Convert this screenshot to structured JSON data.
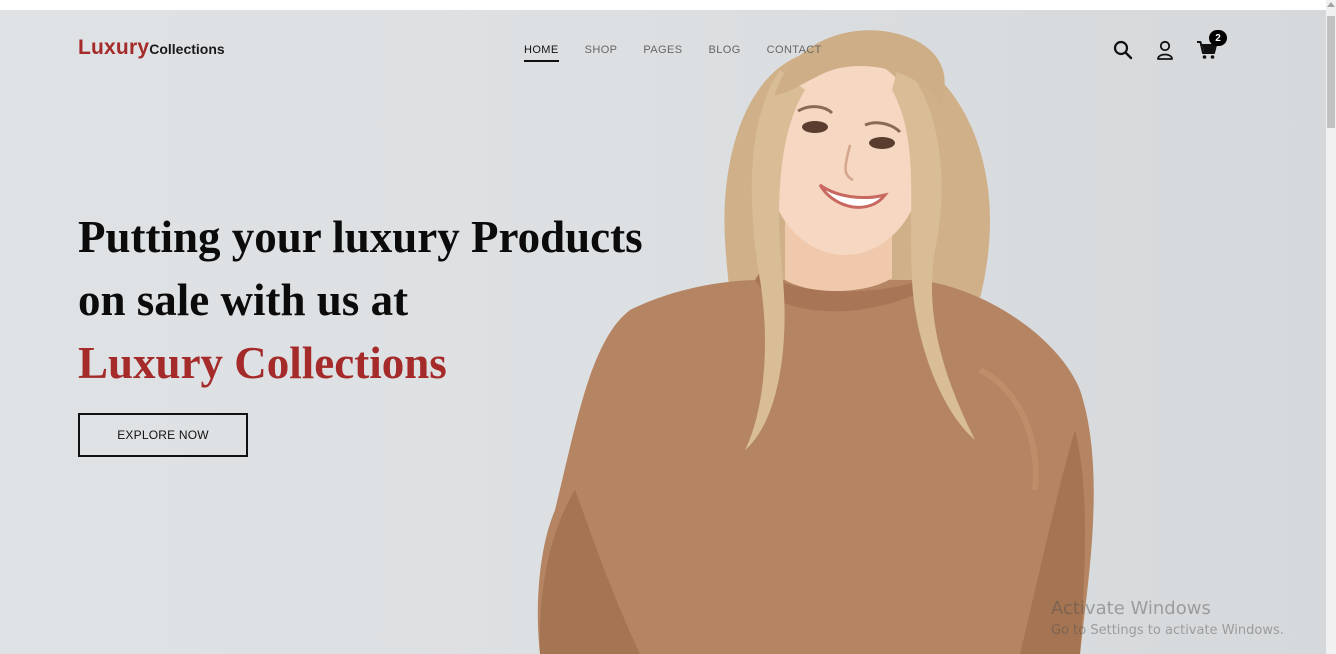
{
  "header": {
    "logo_main": "Luxury",
    "logo_sub": "Collections",
    "nav": [
      {
        "label": "HOME",
        "active": true
      },
      {
        "label": "SHOP",
        "active": false
      },
      {
        "label": "PAGES",
        "active": false
      },
      {
        "label": "BLOG",
        "active": false
      },
      {
        "label": "CONTACT",
        "active": false
      }
    ],
    "icons": [
      "search-icon",
      "user-icon",
      "cart-icon"
    ],
    "cart_count": "2"
  },
  "hero": {
    "line1": "Putting your luxury Products",
    "line2": "on sale with us at",
    "line3": "Luxury Collections",
    "cta_label": "EXPLORE NOW"
  },
  "watermark": {
    "title": "Activate Windows",
    "subtitle": "Go to Settings to activate Windows."
  },
  "colors": {
    "brand": "#a52a2a",
    "background": "#dde0e2",
    "text": "#0b0b0b",
    "sweater": "#b58563",
    "hair": "#d8bd96"
  }
}
